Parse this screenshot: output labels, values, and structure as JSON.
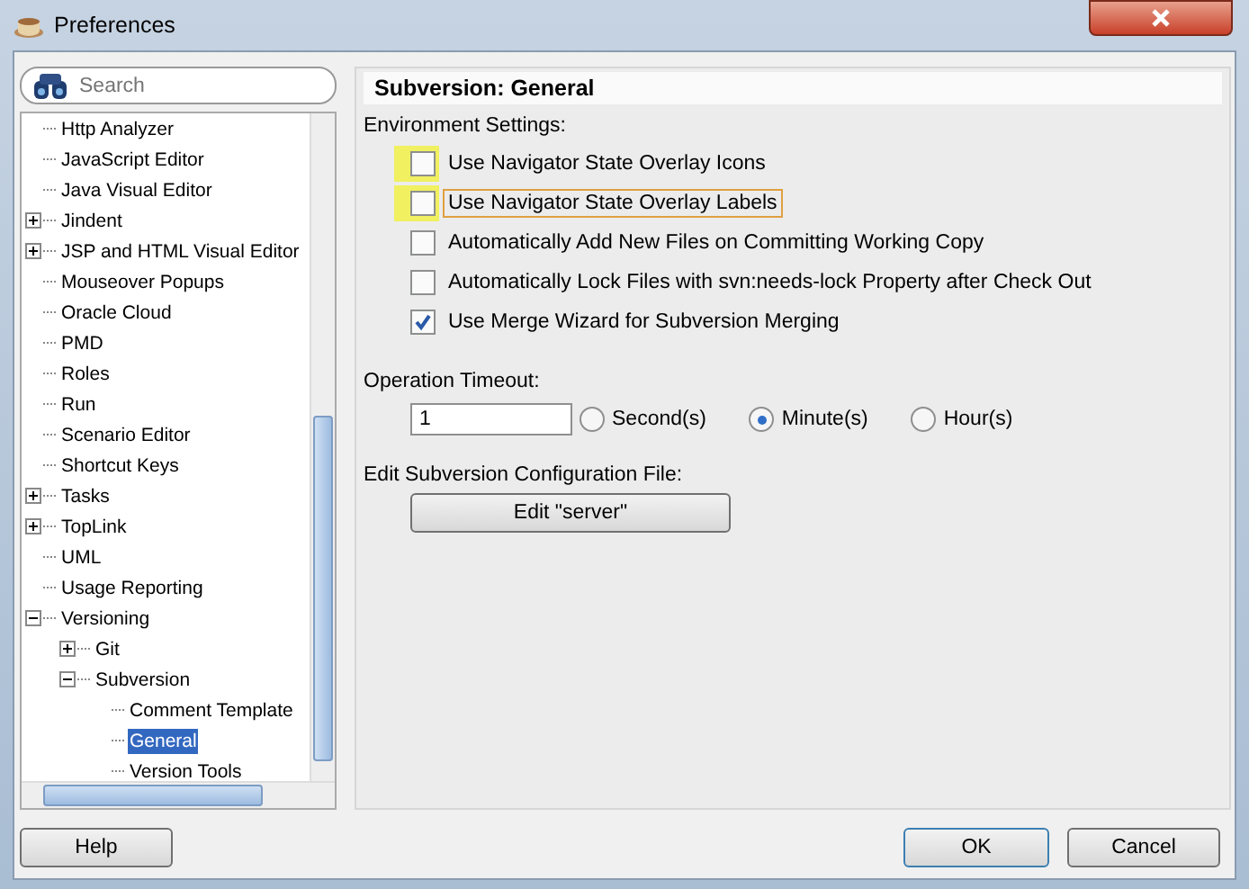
{
  "window": {
    "title": "Preferences"
  },
  "search": {
    "placeholder": "Search"
  },
  "tree": [
    {
      "label": "Http Analyzer",
      "selected": false
    },
    {
      "label": "JavaScript Editor",
      "selected": false
    },
    {
      "label": "Java Visual Editor",
      "selected": false
    },
    {
      "label": "Jindent",
      "selected": false,
      "expanded": false
    },
    {
      "label": "JSP and HTML Visual Editor",
      "selected": false,
      "expanded": false
    },
    {
      "label": "Mouseover Popups",
      "selected": false
    },
    {
      "label": "Oracle Cloud",
      "selected": false
    },
    {
      "label": "PMD",
      "selected": false
    },
    {
      "label": "Roles",
      "selected": false
    },
    {
      "label": "Run",
      "selected": false
    },
    {
      "label": "Scenario Editor",
      "selected": false
    },
    {
      "label": "Shortcut Keys",
      "selected": false
    },
    {
      "label": "Tasks",
      "selected": false,
      "expanded": false
    },
    {
      "label": "TopLink",
      "selected": false,
      "expanded": false
    },
    {
      "label": "UML",
      "selected": false
    },
    {
      "label": "Usage Reporting",
      "selected": false
    },
    {
      "label": "Versioning",
      "selected": false,
      "expanded": true,
      "children": [
        {
          "label": "Git",
          "selected": false,
          "expanded": false
        },
        {
          "label": "Subversion",
          "selected": false,
          "expanded": true,
          "children": [
            {
              "label": "Comment Template",
              "selected": false
            },
            {
              "label": "General",
              "selected": true
            },
            {
              "label": "Version Tools",
              "selected": false
            }
          ]
        }
      ]
    }
  ],
  "panel": {
    "title": "Subversion: General",
    "environment": {
      "label": "Environment Settings:",
      "options": [
        {
          "label": "Use Navigator State Overlay Icons",
          "checked": false,
          "highlighted": true,
          "focused": false
        },
        {
          "label": "Use Navigator State Overlay Labels",
          "checked": false,
          "highlighted": true,
          "focused": true
        },
        {
          "label": "Automatically Add New Files on Committing Working Copy",
          "checked": false,
          "highlighted": false,
          "focused": false
        },
        {
          "label": "Automatically Lock Files with svn:needs-lock Property after Check Out",
          "checked": false,
          "highlighted": false,
          "focused": false
        },
        {
          "label": "Use Merge Wizard for Subversion Merging",
          "checked": true,
          "highlighted": false,
          "focused": false
        }
      ]
    },
    "timeout": {
      "label": "Operation Timeout:",
      "value": "1",
      "units": [
        {
          "label": "Second(s)",
          "selected": false
        },
        {
          "label": "Minute(s)",
          "selected": true
        },
        {
          "label": "Hour(s)",
          "selected": false
        }
      ]
    },
    "config": {
      "label": "Edit Subversion Configuration File:",
      "button": "Edit \"server\""
    }
  },
  "buttons": {
    "help": "Help",
    "ok": "OK",
    "cancel": "Cancel"
  }
}
